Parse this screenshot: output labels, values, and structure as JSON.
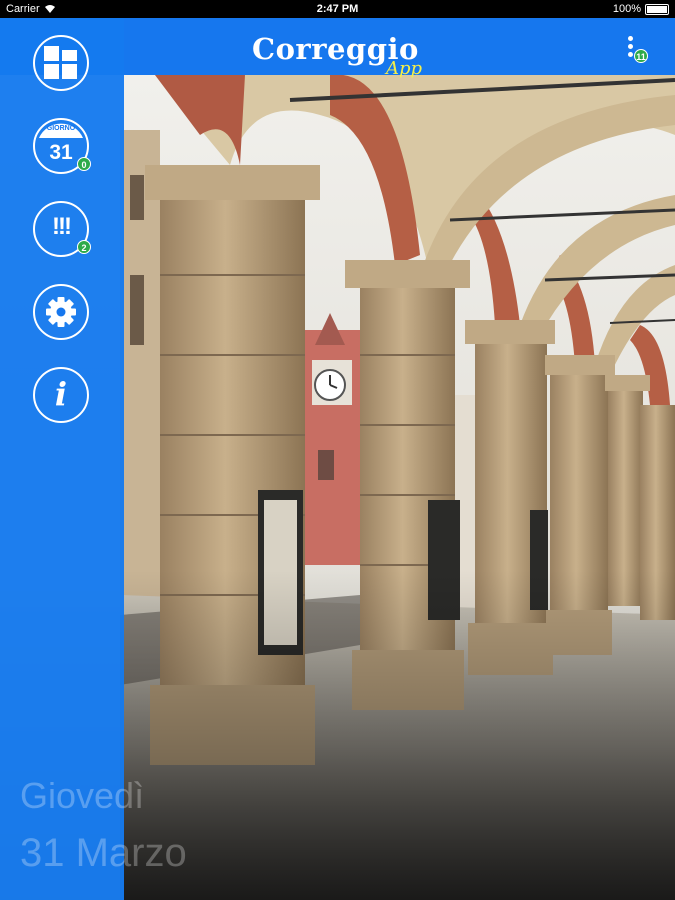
{
  "status_bar": {
    "carrier": "Carrier",
    "time": "2:47 PM",
    "battery": "100%"
  },
  "header": {
    "logo_main": "Correggio",
    "logo_sub": "App",
    "menu_badge": "11"
  },
  "sidebar": {
    "items": [
      {
        "name": "home",
        "icon": "grid-icon"
      },
      {
        "name": "calendar",
        "icon": "calendar-icon",
        "calendar_label": "GIORNO",
        "calendar_day": "31",
        "badge": "0"
      },
      {
        "name": "alerts",
        "icon": "alert-icon",
        "glyph": "!!!",
        "badge": "2"
      },
      {
        "name": "settings",
        "icon": "gear-icon"
      },
      {
        "name": "info",
        "icon": "info-icon",
        "glyph": "i"
      }
    ]
  },
  "date_overlay": {
    "weekday": "Giovedì",
    "day": "31 Marzo"
  },
  "colors": {
    "primary_blue": "#1677ee",
    "badge_green": "#2eaa4a",
    "logo_yellow": "#f5ef4a"
  }
}
